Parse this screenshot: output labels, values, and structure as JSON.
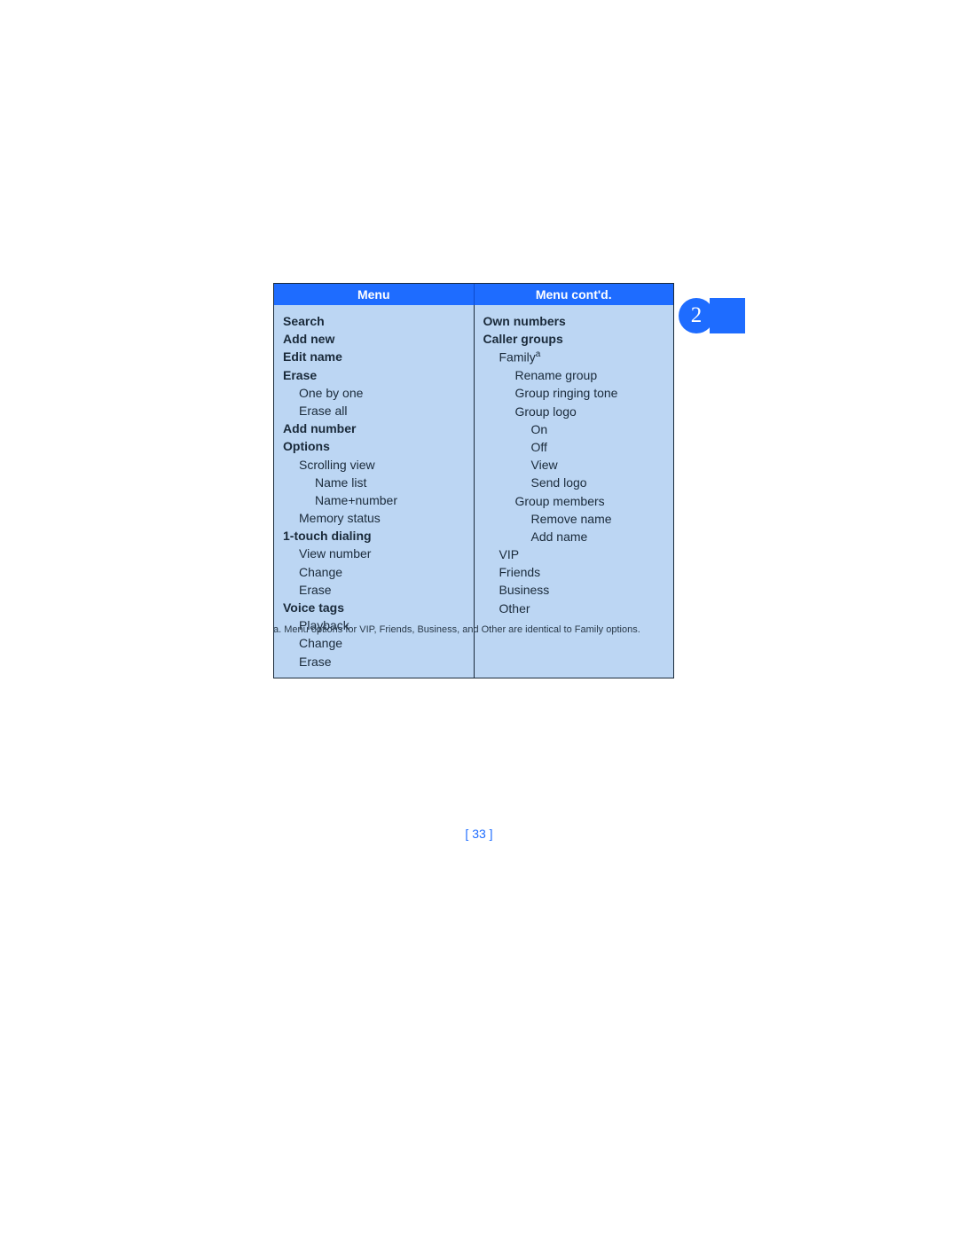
{
  "chapter_badge": "2",
  "headers": {
    "left": "Menu",
    "right": "Menu cont'd."
  },
  "left": {
    "search": "Search",
    "add_new": "Add new",
    "edit_name": "Edit name",
    "erase": "Erase",
    "erase_one": "One by one",
    "erase_all": "Erase all",
    "add_number": "Add number",
    "options": "Options",
    "opt_scrolling_view": "Scrolling view",
    "opt_name_list": "Name list",
    "opt_name_number": "Name+number",
    "opt_memory_status": "Memory status",
    "one_touch": "1-touch dialing",
    "ot_view_number": "View number",
    "ot_change": "Change",
    "ot_erase": "Erase",
    "voice_tags": "Voice tags",
    "vt_playback": "Playback",
    "vt_change": "Change",
    "vt_erase": "Erase"
  },
  "right": {
    "own_numbers": "Own numbers",
    "caller_groups": "Caller groups",
    "family": "Family",
    "family_sup": "a",
    "rename_group": "Rename group",
    "ringing_tone": "Group ringing tone",
    "group_logo": "Group logo",
    "gl_on": "On",
    "gl_off": "Off",
    "gl_view": "View",
    "gl_send": "Send logo",
    "group_members": "Group members",
    "gm_remove": "Remove name",
    "gm_add": "Add name",
    "vip": "VIP",
    "friends": "Friends",
    "business": "Business",
    "other": "Other"
  },
  "footnote": {
    "marker": "a.",
    "text": "Menu options for VIP, Friends, Business, and Other are identical to Family options."
  },
  "page_number": "[ 33 ]"
}
